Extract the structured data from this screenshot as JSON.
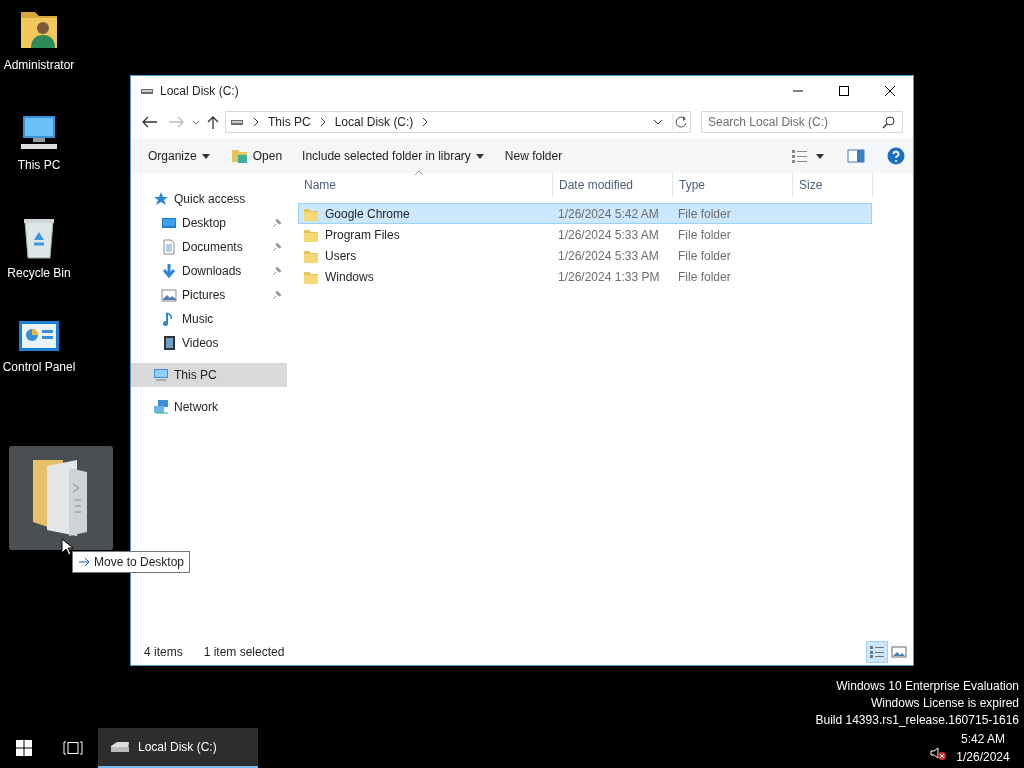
{
  "desktop_icons": [
    {
      "label": "Administrator",
      "kind": "user"
    },
    {
      "label": "This PC",
      "kind": "pc"
    },
    {
      "label": "Recycle Bin",
      "kind": "recycle"
    },
    {
      "label": "Control Panel",
      "kind": "control"
    }
  ],
  "drag": {
    "tooltip": "Move to Desktop"
  },
  "window": {
    "title": "Local Disk (C:)",
    "address": [
      "This PC",
      "Local Disk (C:)"
    ],
    "search": {
      "placeholder": "Search Local Disk (C:)"
    },
    "commands": [
      {
        "label": "Organize",
        "kind": "menu"
      },
      {
        "label": "Open",
        "kind": "open"
      },
      {
        "label": "Include selected folder in library",
        "kind": "menu"
      },
      {
        "label": "New folder",
        "kind": "plain"
      }
    ],
    "columns": [
      "Name",
      "Date modified",
      "Type",
      "Size"
    ],
    "nav": [
      {
        "label": "Quick access",
        "kind": "star",
        "selected": false,
        "children": [
          {
            "label": "Desktop",
            "kind": "desktop",
            "selected": false,
            "pinned": true
          },
          {
            "label": "Documents",
            "kind": "document",
            "selected": false,
            "pinned": true
          },
          {
            "label": "Downloads",
            "kind": "download",
            "selected": false,
            "pinned": true
          },
          {
            "label": "Pictures",
            "kind": "pictures",
            "selected": false,
            "pinned": true
          },
          {
            "label": "Music",
            "kind": "music",
            "selected": false,
            "pinned": false
          },
          {
            "label": "Videos",
            "kind": "videos",
            "selected": false,
            "pinned": false
          }
        ]
      },
      {
        "label": "This PC",
        "kind": "pc",
        "selected": true
      },
      {
        "label": "Network",
        "kind": "network",
        "selected": false
      }
    ],
    "files": [
      {
        "name": "Google Chrome",
        "date": "1/26/2024 5:42 AM",
        "type": "File folder",
        "selected": true
      },
      {
        "name": "Program Files",
        "date": "1/26/2024 5:33 AM",
        "type": "File folder",
        "selected": false
      },
      {
        "name": "Users",
        "date": "1/26/2024 5:33 AM",
        "type": "File folder",
        "selected": false
      },
      {
        "name": "Windows",
        "date": "1/26/2024 1:33 PM",
        "type": "File folder",
        "selected": false
      }
    ],
    "status": {
      "count": "4 items",
      "selection": "1 item selected"
    },
    "views": [
      {
        "kind": "details",
        "selected": true
      },
      {
        "kind": "thumbnails",
        "selected": false
      }
    ]
  },
  "system_notice": [
    "Windows 10 Enterprise Evaluation",
    "Windows License is expired",
    "Build 14393.rs1_release.160715-1616"
  ],
  "taskbar": {
    "tasks": [
      {
        "label": "Local Disk (C:)",
        "active": true
      }
    ],
    "sound_muted": true,
    "time": "5:42 AM",
    "date": "1/26/2024"
  }
}
